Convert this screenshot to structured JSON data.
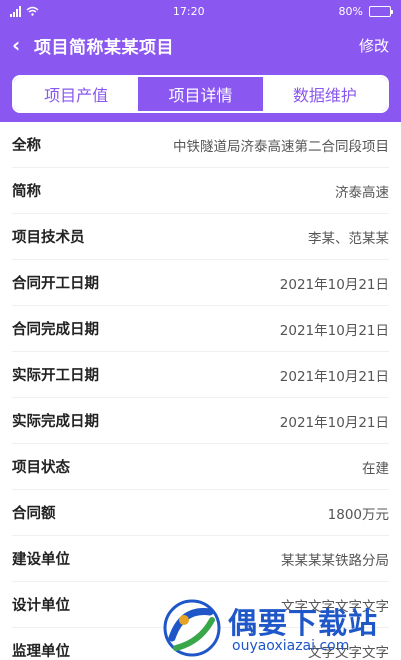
{
  "status": {
    "time": "17:20",
    "battery": "80%"
  },
  "header": {
    "title": "项目简称某某项目",
    "action_label": "修改"
  },
  "tabs": [
    {
      "label": "项目产值",
      "active": false
    },
    {
      "label": "项目详情",
      "active": true
    },
    {
      "label": "数据维护",
      "active": false
    }
  ],
  "details": [
    {
      "label": "全称",
      "value": "中铁隧道局济泰高速第二合同段项目"
    },
    {
      "label": "简称",
      "value": "济泰高速"
    },
    {
      "label": "项目技术员",
      "value": "李某、范某某"
    },
    {
      "label": "合同开工日期",
      "value": "2021年10月21日"
    },
    {
      "label": "合同完成日期",
      "value": "2021年10月21日"
    },
    {
      "label": "实际开工日期",
      "value": "2021年10月21日"
    },
    {
      "label": "实际完成日期",
      "value": "2021年10月21日"
    },
    {
      "label": "项目状态",
      "value": "在建"
    },
    {
      "label": "合同额",
      "value": "1800万元"
    },
    {
      "label": "建设单位",
      "value": "某某某某铁路分局"
    },
    {
      "label": "设计单位",
      "value": "文字文字文字文字"
    },
    {
      "label": "监理单位",
      "value": "文字文字文字"
    }
  ],
  "watermark": {
    "title": "偶要下载站",
    "url": "ouyaoxiazai.com"
  },
  "colors": {
    "accent": "#8a57f0",
    "watermark": "#1f57c9"
  }
}
